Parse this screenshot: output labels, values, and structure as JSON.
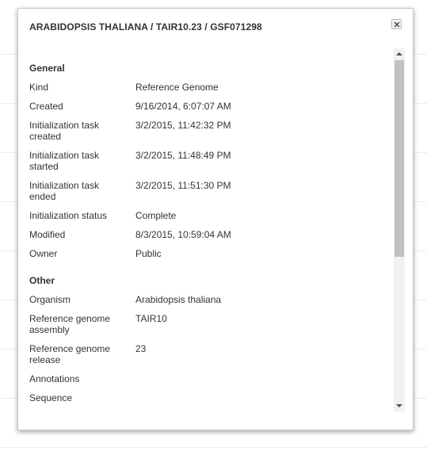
{
  "dialog": {
    "title": "ARABIDOPSIS THALIANA / TAIR10.23 / GSF071298",
    "close_icon": "close-icon"
  },
  "sections": {
    "general": {
      "heading": "General",
      "rows": [
        {
          "label": "Kind",
          "value": "Reference Genome"
        },
        {
          "label": "Created",
          "value": "9/16/2014, 6:07:07 AM"
        },
        {
          "label": "Initialization task created",
          "value": "3/2/2015, 11:42:32 PM"
        },
        {
          "label": "Initialization task started",
          "value": "3/2/2015, 11:48:49 PM"
        },
        {
          "label": "Initialization task ended",
          "value": "3/2/2015, 11:51:30 PM"
        },
        {
          "label": "Initialization status",
          "value": "Complete"
        },
        {
          "label": "Modified",
          "value": "8/3/2015, 10:59:04 AM"
        },
        {
          "label": "Owner",
          "value": "Public"
        }
      ]
    },
    "other": {
      "heading": "Other",
      "rows": [
        {
          "label": "Organism",
          "value": "Arabidopsis thaliana"
        },
        {
          "label": "Reference genome assembly",
          "value": "TAIR10"
        },
        {
          "label": "Reference genome release",
          "value": "23"
        },
        {
          "label": "Annotations",
          "value": ""
        },
        {
          "label": "Sequence",
          "value": ""
        }
      ]
    }
  },
  "colors": {
    "text": "#333333",
    "border": "#c8c8c8",
    "scroll_thumb": "#c1c1c1",
    "scroll_track": "#f1f1f1"
  }
}
